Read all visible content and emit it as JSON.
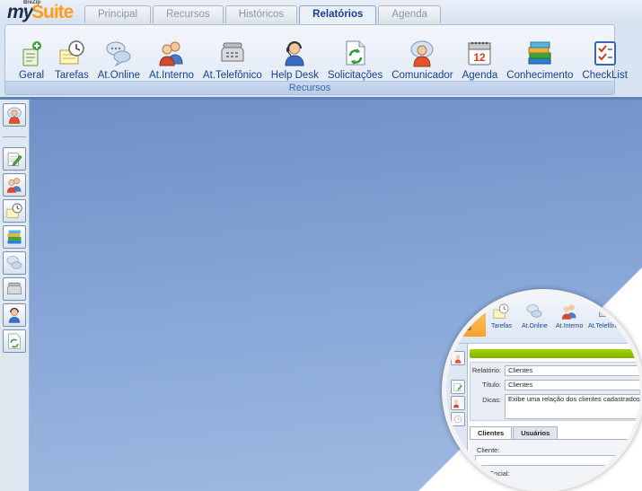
{
  "logo": {
    "brand_small": "BreZip",
    "brand_my": "my",
    "brand_suite": "Suite"
  },
  "tabs": [
    {
      "label": "Principal",
      "active": false
    },
    {
      "label": "Recursos",
      "active": false
    },
    {
      "label": "Históricos",
      "active": false
    },
    {
      "label": "Relatórios",
      "active": true
    },
    {
      "label": "Agenda",
      "active": false
    }
  ],
  "ribbon": {
    "group_label": "Recursos",
    "items": [
      {
        "label": "Geral",
        "icon": "geral-icon"
      },
      {
        "label": "Tarefas",
        "icon": "tarefas-icon"
      },
      {
        "label": "At.Online",
        "icon": "chat-bubbles-icon"
      },
      {
        "label": "At.Interno",
        "icon": "users-icon"
      },
      {
        "label": "At.Telefônico",
        "icon": "telephone-icon"
      },
      {
        "label": "Help Desk",
        "icon": "headset-icon"
      },
      {
        "label": "Solicitações",
        "icon": "document-refresh-icon"
      },
      {
        "label": "Comunicador",
        "icon": "messenger-icon"
      },
      {
        "label": "Agenda",
        "icon": "calendar-icon",
        "calendar_day": "12"
      },
      {
        "label": "Conhecimento",
        "icon": "books-icon"
      },
      {
        "label": "CheckList",
        "icon": "checklist-icon"
      }
    ]
  },
  "left_toolbar": {
    "items": [
      {
        "icon": "messenger-icon"
      },
      {
        "icon": "edit-note-icon"
      },
      {
        "icon": "users-icon"
      },
      {
        "icon": "tarefas-icon"
      },
      {
        "icon": "books-icon"
      },
      {
        "icon": "chat-bubbles-icon"
      },
      {
        "icon": "telephone-icon"
      },
      {
        "icon": "headset-icon"
      },
      {
        "icon": "document-refresh-icon"
      }
    ]
  },
  "magnifier": {
    "ribbon_items": [
      "ral",
      "Tarefas",
      "At.Online",
      "At.Interno",
      "At.Telefônico"
    ],
    "form": {
      "relatorio_label": "Relatório:",
      "relatorio_value": "Clientes",
      "titulo_label": "Título:",
      "titulo_value": "Clientes",
      "dicas_label": "Dicas:",
      "dicas_value": "Exibe uma relação dos clientes cadastrados."
    },
    "tabs": [
      "Clientes",
      "Usuários"
    ],
    "panel": {
      "cliente_label": "Cliente:",
      "razao_label": "zão Social:"
    }
  },
  "colors": {
    "ribbon_text": "#15428b",
    "workspace_top": "#6f8fc7",
    "workspace_bottom": "#9fbbe3",
    "logo_orange": "#ff9d1c",
    "logo_dark": "#1f2c4c",
    "magnifier_green": "#8fc000"
  }
}
